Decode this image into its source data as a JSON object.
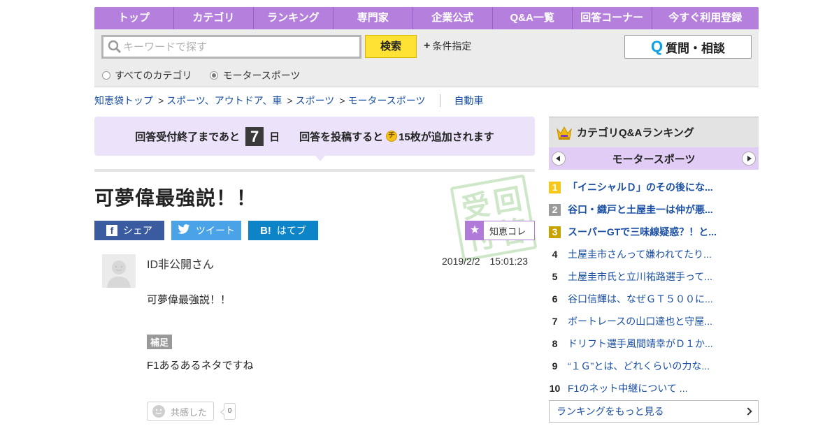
{
  "nav": {
    "items": [
      "トップ",
      "カテゴリ",
      "ランキング",
      "専門家",
      "企業公式",
      "Q&A一覧",
      "回答コーナー",
      "今すぐ利用登録"
    ]
  },
  "search": {
    "placeholder": "キーワードで探す",
    "value": "",
    "button_label": "検索",
    "conditions_label": "条件指定",
    "ask_q": "Q",
    "ask_label": "質問・相談",
    "scope_options": [
      {
        "label": "すべてのカテゴリ",
        "selected": false
      },
      {
        "label": "モータースポーツ",
        "selected": true
      }
    ]
  },
  "breadcrumb": {
    "items": [
      "知恵袋トップ",
      "スポーツ、アウトドア、車",
      "スポーツ",
      "モータースポーツ"
    ],
    "separator": ">",
    "related": "自動車"
  },
  "deadline": {
    "prefix": "回答受付終了まであと",
    "days": "7",
    "days_unit": "日",
    "reward_prefix": "回答を投稿すると",
    "coin_icon": "チ",
    "reward_suffix": "15枚が追加されます"
  },
  "question": {
    "title": "可夢偉最強説！！",
    "stamp_chars": [
      "受",
      "回",
      "付",
      "答"
    ],
    "user": "ID非公開さん",
    "datetime": "2019/2/2　15:01:23",
    "body": "可夢偉最強説！！",
    "supplement_label": "補足",
    "supplement": "F1あるあるネタですね",
    "empathy_label": "共感した",
    "empathy_count": "0"
  },
  "share": {
    "facebook": {
      "icon": "f",
      "label": "シェア"
    },
    "twitter": {
      "label": "ツイート"
    },
    "hatena": {
      "icon": "B!",
      "label": "はてブ"
    }
  },
  "collect": {
    "icon": "★",
    "label": "知恵コレ"
  },
  "sidebar": {
    "title": "カテゴリQ&Aランキング",
    "category": "モータースポーツ",
    "ranking": [
      {
        "no": "1",
        "text": "「イニシャルＤ」のその後にな..."
      },
      {
        "no": "2",
        "text": "谷口・織戸と土屋圭一は仲が悪..."
      },
      {
        "no": "3",
        "text": "スーパーGTで三味線疑惑？！と..."
      },
      {
        "no": "4",
        "text": "土屋圭市さんって嫌われてたり..."
      },
      {
        "no": "5",
        "text": "土屋圭市氏と立川祐路選手って..."
      },
      {
        "no": "6",
        "text": "谷口信輝は、なぜＧＴ５００に..."
      },
      {
        "no": "7",
        "text": "ボートレースの山口達也と守屋..."
      },
      {
        "no": "8",
        "text": "ドリフト選手風間靖幸がＤ１か..."
      },
      {
        "no": "9",
        "text": "“１Ｇ”とは、どれくらいの力な..."
      },
      {
        "no": "10",
        "text": "F1のネット中継について ..."
      }
    ],
    "more_label": "ランキングをもっと見る"
  },
  "colors": {
    "nav_bg": "#b580dd",
    "deadline_bg": "#ece3fb",
    "link": "#1a4fa3",
    "search_button": "#ffe233",
    "rank_gold": "#f7c71a",
    "rank_silver": "#9a9a9a",
    "rank_bronze": "#c8a200"
  }
}
